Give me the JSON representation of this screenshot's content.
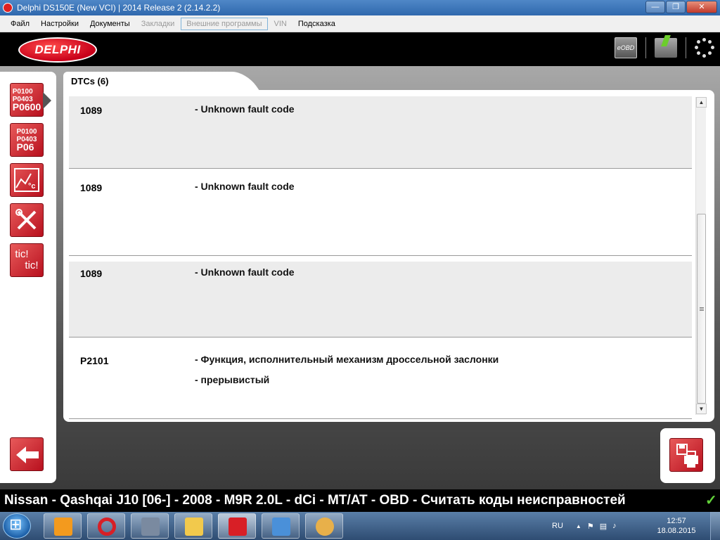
{
  "window": {
    "title": "Delphi DS150E (New VCI) | 2014 Release 2 (2.14.2.2)",
    "controls": {
      "minimize": "—",
      "maximize": "❐",
      "close": "✕"
    }
  },
  "menu": {
    "items": [
      {
        "label": "Файл",
        "state": "enabled"
      },
      {
        "label": "Настройки",
        "state": "enabled"
      },
      {
        "label": "Документы",
        "state": "enabled"
      },
      {
        "label": "Закладки",
        "state": "disabled"
      },
      {
        "label": "Внешние программы",
        "state": "disabled-boxed"
      },
      {
        "label": "VIN",
        "state": "disabled"
      },
      {
        "label": "Подсказка",
        "state": "enabled"
      }
    ]
  },
  "header": {
    "logo": "DELPHI",
    "eobd_label": "eOBD"
  },
  "sidebar": {
    "dtc_read": {
      "line1": "P0100",
      "line2": "P0403",
      "line3": "P0600"
    },
    "dtc_clear": {
      "line1": "P0100",
      "line2": "P0403",
      "line3": "P06"
    },
    "live_data": {
      "text": "°c"
    },
    "tic_tic": {
      "line1": "tic!",
      "line2": "tic!"
    }
  },
  "tab": {
    "label": "DTCs (6)"
  },
  "dtc_rows": [
    {
      "code": "1089",
      "desc": [
        "- Unknown fault code"
      ],
      "shaded": true
    },
    {
      "code": "1089",
      "desc": [
        "- Unknown fault code"
      ],
      "shaded": false
    },
    {
      "code": "1089",
      "desc": [
        "- Unknown fault code"
      ],
      "shaded": true
    },
    {
      "code": "P2101",
      "desc": [
        "- Функция, исполнительный механизм дроссельной заслонки",
        "- прерывистый"
      ],
      "shaded": false
    }
  ],
  "scrollbar": {
    "up": "▲",
    "down": "▼"
  },
  "status": {
    "text": "Nissan - Qashqai J10 [06-] - 2008 - M9R 2.0L - dCi - MT/AT - OBD - Считать коды неисправностей",
    "check": "✓"
  },
  "taskbar": {
    "apps": [
      {
        "name": "media-player",
        "color": "#f39a1e"
      },
      {
        "name": "opera",
        "color": "#d81f26"
      },
      {
        "name": "computer",
        "color": "#7a8aa0"
      },
      {
        "name": "file-explorer",
        "color": "#f2c94c"
      },
      {
        "name": "delphi-ds150e",
        "color": "#d81f26"
      },
      {
        "name": "control-panel",
        "color": "#4a90d9"
      },
      {
        "name": "paint",
        "color": "#e8b04a"
      }
    ],
    "language": "RU",
    "tray_up": "▲",
    "time": "12:57",
    "date": "18.08.2015"
  },
  "colors": {
    "accent_red": "#c8001a",
    "header_black": "#000000",
    "status_green": "#62d23a"
  }
}
